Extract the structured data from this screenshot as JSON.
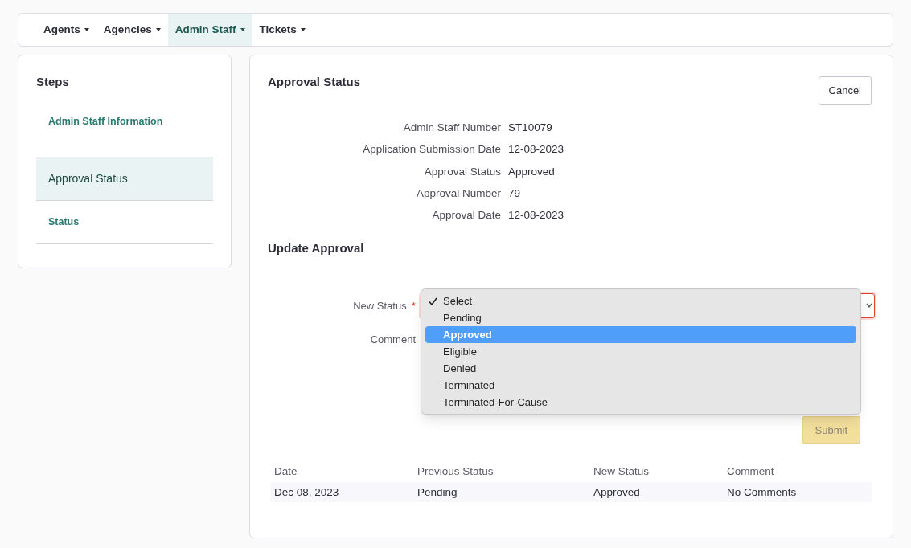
{
  "nav": [
    {
      "label": "Agents",
      "selected": false
    },
    {
      "label": "Agencies",
      "selected": false
    },
    {
      "label": "Admin Staff",
      "selected": true
    },
    {
      "label": "Tickets",
      "selected": false
    }
  ],
  "steps": {
    "title": "Steps",
    "items": [
      {
        "label": "Admin Staff Information",
        "selected": false
      },
      {
        "label": "Approval Status",
        "selected": true
      },
      {
        "label": "Status",
        "selected": false
      }
    ]
  },
  "main": {
    "title": "Approval Status",
    "cancel_button": "Cancel",
    "details": [
      {
        "label": "Admin Staff Number",
        "value": "ST10079"
      },
      {
        "label": "Application Submission Date",
        "value": "12-08-2023"
      },
      {
        "label": "Approval Status",
        "value": "Approved"
      },
      {
        "label": "Approval Number",
        "value": "79"
      },
      {
        "label": "Approval Date",
        "value": "12-08-2023"
      }
    ],
    "update_title": "Update Approval",
    "new_status": {
      "label": "New Status",
      "required": true,
      "required_mark": "*",
      "invalid": true,
      "options": [
        {
          "label": "Select",
          "checked": true,
          "selected": false
        },
        {
          "label": "Pending",
          "checked": false,
          "selected": false
        },
        {
          "label": "Approved",
          "checked": false,
          "selected": true
        },
        {
          "label": "Eligible",
          "checked": false,
          "selected": false
        },
        {
          "label": "Denied",
          "checked": false,
          "selected": false
        },
        {
          "label": "Terminated",
          "checked": false,
          "selected": false
        },
        {
          "label": "Terminated-For-Cause",
          "checked": false,
          "selected": false
        }
      ]
    },
    "comment": {
      "label": "Comment"
    },
    "submit_button": {
      "label": "Submit",
      "disabled": true
    },
    "history": {
      "columns": [
        "Date",
        "Previous Status",
        "New Status",
        "Comment"
      ],
      "rows": [
        [
          "Dec 08, 2023",
          "Pending",
          "Approved",
          "No Comments"
        ]
      ]
    }
  }
}
